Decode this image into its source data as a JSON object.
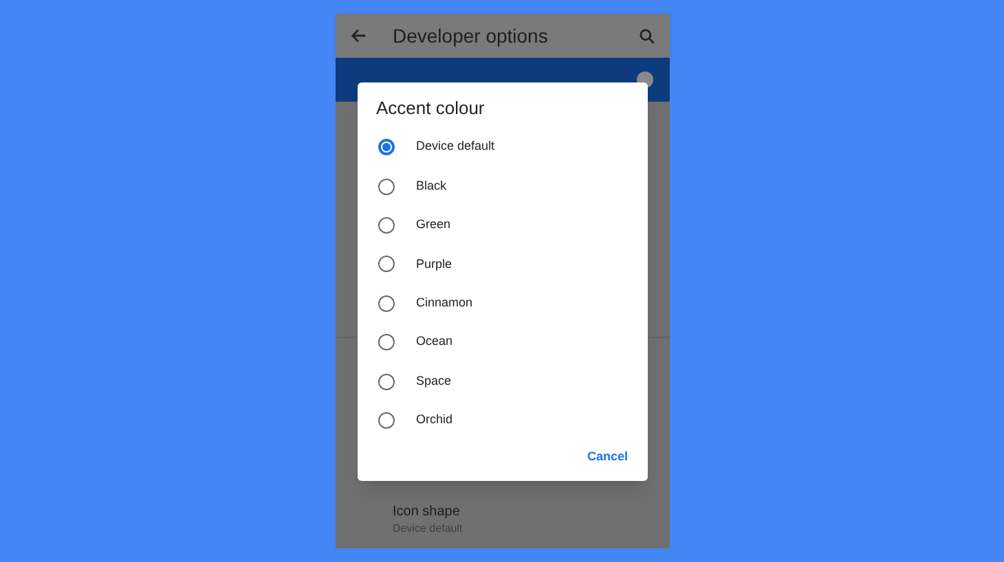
{
  "app_bar": {
    "title": "Developer options"
  },
  "setting": {
    "title": "Icon shape",
    "value": "Device default"
  },
  "dialog": {
    "title": "Accent colour",
    "options": [
      {
        "label": "Device default",
        "selected": true
      },
      {
        "label": "Black",
        "selected": false
      },
      {
        "label": "Green",
        "selected": false
      },
      {
        "label": "Purple",
        "selected": false
      },
      {
        "label": "Cinnamon",
        "selected": false
      },
      {
        "label": "Ocean",
        "selected": false
      },
      {
        "label": "Space",
        "selected": false
      },
      {
        "label": "Orchid",
        "selected": false
      }
    ],
    "buttons": [
      "Cancel"
    ]
  }
}
